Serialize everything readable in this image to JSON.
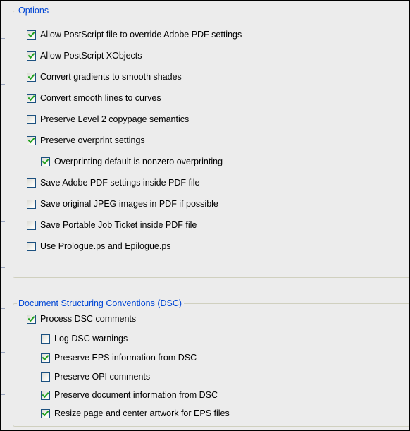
{
  "options": {
    "title": "Options",
    "items": [
      {
        "label": "Allow PostScript file to override Adobe PDF settings",
        "checked": true
      },
      {
        "label": "Allow PostScript XObjects",
        "checked": true
      },
      {
        "label": "Convert gradients to smooth shades",
        "checked": true
      },
      {
        "label": "Convert smooth lines to curves",
        "checked": true
      },
      {
        "label": "Preserve Level 2 copypage semantics",
        "checked": false
      },
      {
        "label": "Preserve overprint settings",
        "checked": true
      },
      {
        "label": "Overprinting default is nonzero overprinting",
        "checked": true
      },
      {
        "label": "Save Adobe PDF settings inside PDF file",
        "checked": false
      },
      {
        "label": "Save original JPEG images in PDF if possible",
        "checked": false
      },
      {
        "label": "Save Portable Job Ticket inside PDF file",
        "checked": false
      },
      {
        "label": "Use Prologue.ps and Epilogue.ps",
        "checked": false
      }
    ]
  },
  "dsc": {
    "title": "Document Structuring Conventions (DSC)",
    "items": [
      {
        "label": "Process DSC comments",
        "checked": true
      },
      {
        "label": "Log DSC warnings",
        "checked": false
      },
      {
        "label": "Preserve EPS information from DSC",
        "checked": true
      },
      {
        "label": "Preserve OPI comments",
        "checked": false
      },
      {
        "label": "Preserve document information from DSC",
        "checked": true
      },
      {
        "label": "Resize page and center artwork for EPS files",
        "checked": true
      }
    ]
  },
  "colors": {
    "legend": "#0046d5",
    "checkbox_border": "#1c5180",
    "checkmark": "#21a121",
    "panel_background": "#ececec",
    "group_border": "#d0d0bf"
  },
  "icons": {
    "checkbox_checked": "checkbox-checked-icon",
    "checkbox_unchecked": "checkbox-unchecked-icon"
  }
}
